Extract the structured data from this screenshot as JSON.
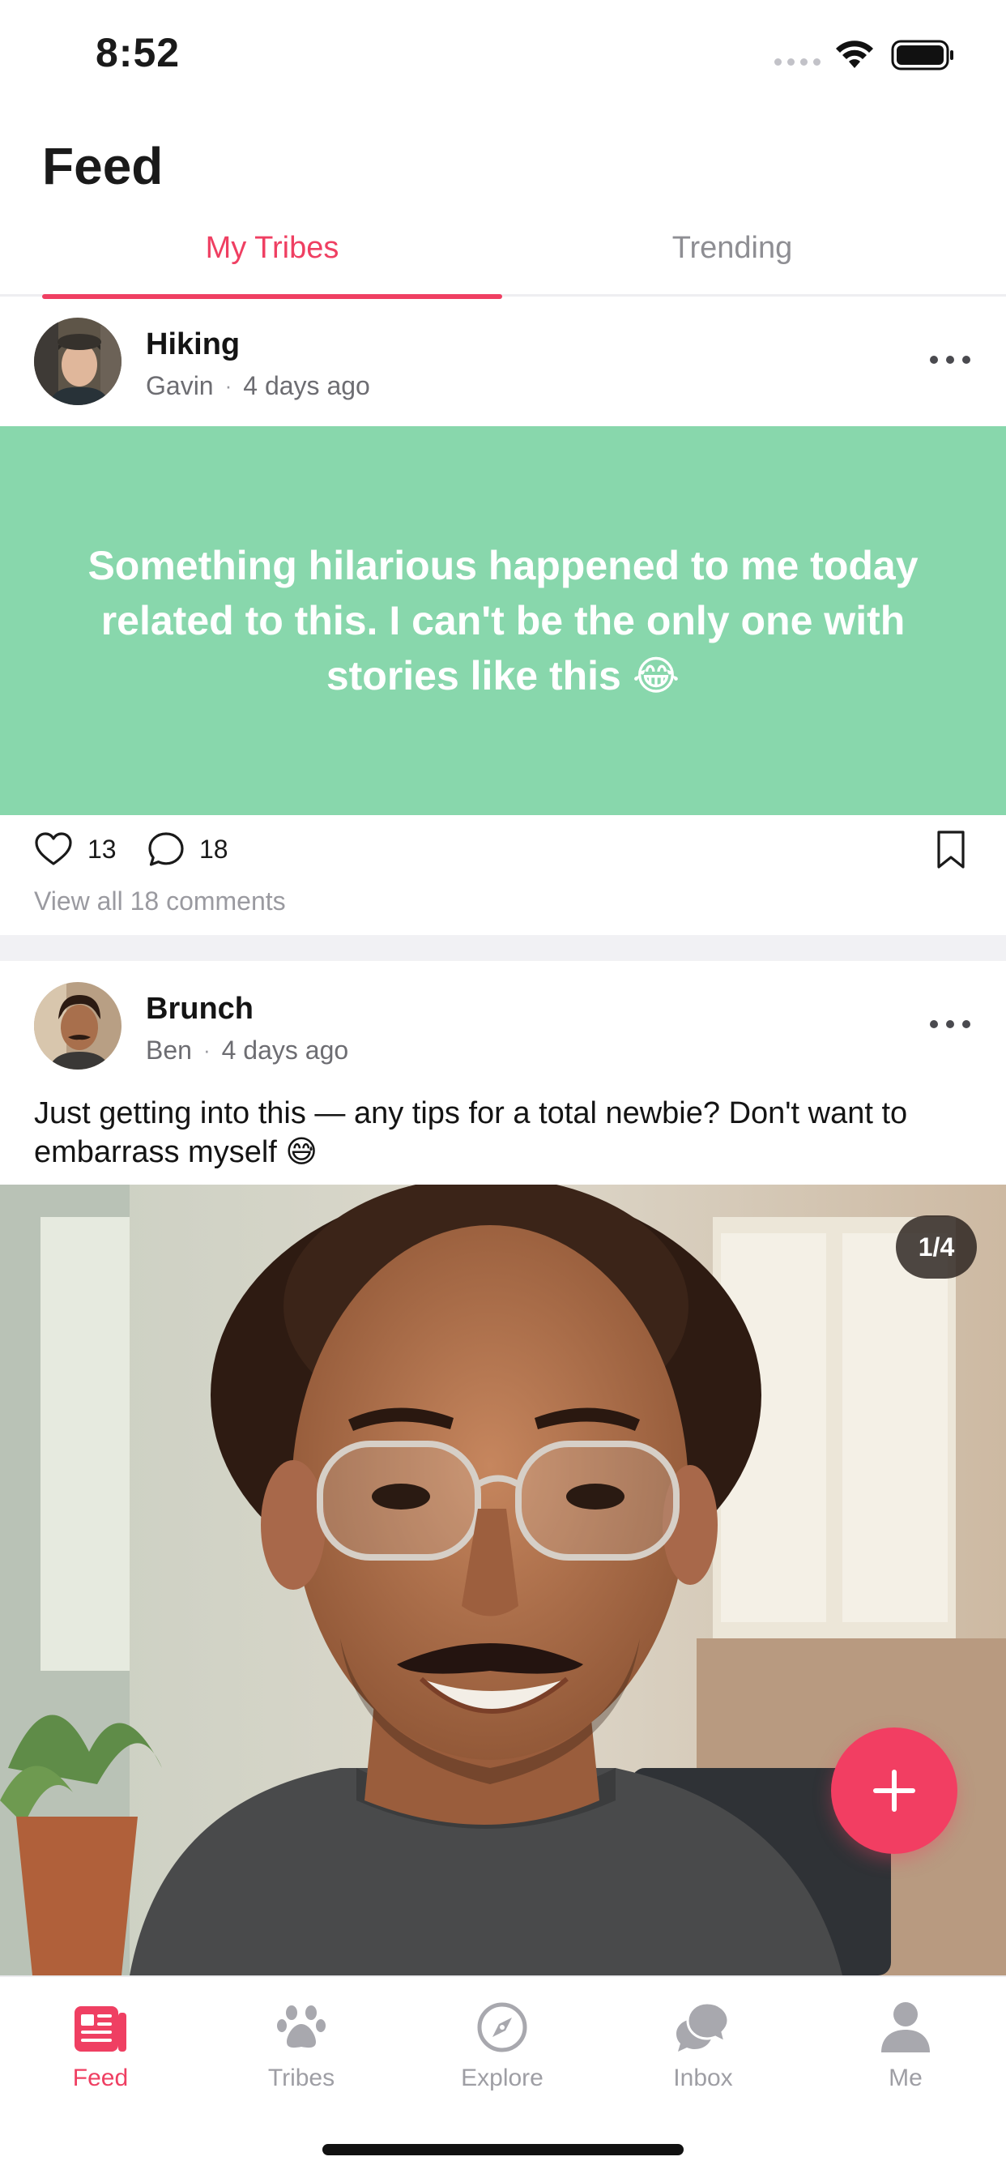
{
  "status_bar": {
    "time": "8:52"
  },
  "header": {
    "title": "Feed"
  },
  "tabs": [
    {
      "label": "My Tribes",
      "active": true
    },
    {
      "label": "Trending",
      "active": false
    }
  ],
  "posts": [
    {
      "tribe": "Hiking",
      "author": "Gavin",
      "time": "4 days ago",
      "text": "Something hilarious happened to me today related to this. I can't be the only one with stories like this 😂",
      "card_color": "#88d7ac",
      "likes": "13",
      "comments": "18",
      "view_all": "View all 18 comments"
    },
    {
      "tribe": "Brunch",
      "author": "Ben",
      "time": "4 days ago",
      "caption": "Just getting into this — any tips for a total newbie? Don't want to embarrass myself 😅",
      "photo_counter": "1/4"
    }
  ],
  "fab": {
    "icon": "plus-icon",
    "color": "#f23e62"
  },
  "tabbar": [
    {
      "label": "Feed",
      "icon": "feed-icon",
      "active": true
    },
    {
      "label": "Tribes",
      "icon": "paw-icon",
      "active": false
    },
    {
      "label": "Explore",
      "icon": "compass-icon",
      "active": false
    },
    {
      "label": "Inbox",
      "icon": "chat-bubbles-icon",
      "active": false
    },
    {
      "label": "Me",
      "icon": "person-icon",
      "active": false
    }
  ],
  "colors": {
    "accent": "#ef3f62",
    "inactive": "#9e9ea4"
  }
}
